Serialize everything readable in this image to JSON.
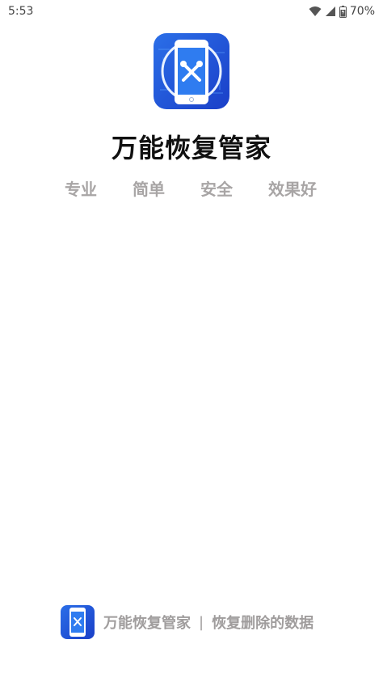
{
  "status_bar": {
    "time": "5:53",
    "battery_percent": "70%"
  },
  "app": {
    "title": "万能恢复管家",
    "slogans": [
      "专业",
      "简单",
      "安全",
      "效果好"
    ]
  },
  "footer": {
    "app_name": "万能恢复管家",
    "separator": "|",
    "tagline": "恢复删除的数据"
  },
  "colors": {
    "icon_blue_dark": "#1a3fd0",
    "icon_blue_light": "#3f8df2",
    "slogan_gray": "#a8a5a5"
  }
}
